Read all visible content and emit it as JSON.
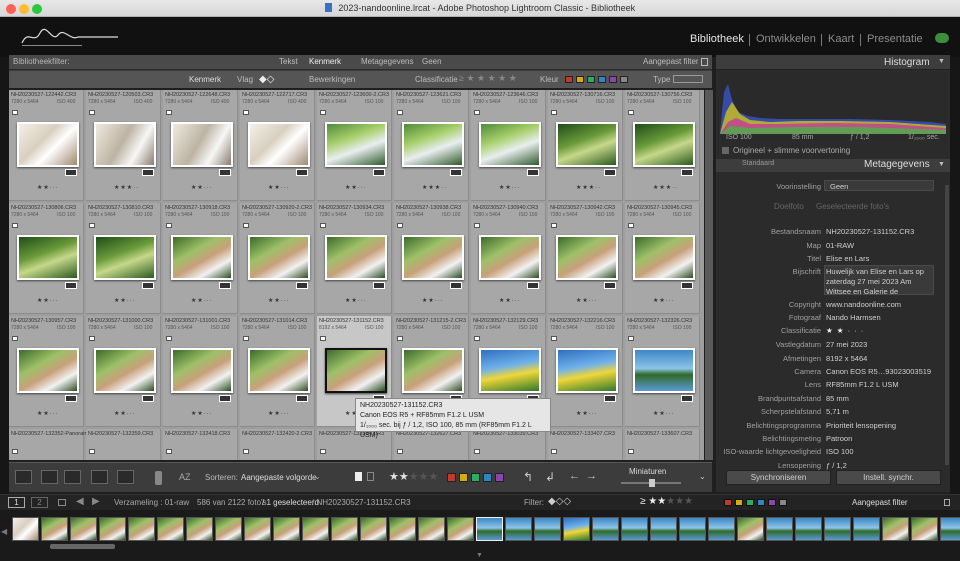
{
  "window": {
    "title": "2023-nandoonline.lrcat - Adobe Photoshop Lightroom Classic - Bibliotheek"
  },
  "modules": [
    "Bibliotheek",
    "Ontwikkelen",
    "Kaart",
    "Presentatie"
  ],
  "filterbar": {
    "title": "Bibliotheekfilter:",
    "tabs": [
      "Tekst",
      "Kenmerk",
      "Metagegevens",
      "Geen"
    ],
    "preset": "Aangepast filter",
    "attr_label": "Kenmerk",
    "flag_label": "Vlag",
    "edits_label": "Bewerkingen",
    "rating_label": "Classificatie",
    "color_label": "Kleur",
    "type_label": "Type",
    "colors": [
      "#c0392b",
      "#d4ac0d",
      "#27ae60",
      "#2e86c1",
      "#8e44ad",
      "#888888"
    ]
  },
  "grid": {
    "rows": [
      [
        {
          "name": "NH20230527-122442.CR3",
          "dims": "7280 x 5464",
          "iso": "ISO 400",
          "stars": 2,
          "thumb": "t-wedding"
        },
        {
          "name": "NH20230527-120503.CR3",
          "dims": "7280 x 5464",
          "iso": "ISO 400",
          "stars": 3,
          "thumb": "t-indoor"
        },
        {
          "name": "NH20230527-122648.CR3",
          "dims": "7280 x 5464",
          "iso": "ISO 400",
          "stars": 2,
          "thumb": "t-indoor"
        },
        {
          "name": "NH20230527-122717.CR3",
          "dims": "7280 x 5464",
          "iso": "ISO 400",
          "stars": 2,
          "thumb": "t-wedding"
        },
        {
          "name": "NH20230527-123600-2.CR3",
          "dims": "7280 x 5464",
          "iso": "ISO 100",
          "stars": 2,
          "thumb": "t-car"
        },
        {
          "name": "NH20230527-123621.CR3",
          "dims": "7280 x 5464",
          "iso": "ISO 100",
          "stars": 3,
          "thumb": "t-car"
        },
        {
          "name": "NH20230527-123646.CR3",
          "dims": "7280 x 5464",
          "iso": "ISO 100",
          "stars": 2,
          "thumb": "t-car"
        },
        {
          "name": "NH20230527-130716.CR3",
          "dims": "7280 x 5464",
          "iso": "ISO 100",
          "stars": 3,
          "thumb": "t-forest"
        },
        {
          "name": "NH20230527-130756.CR3",
          "dims": "7280 x 5464",
          "iso": "ISO 100",
          "stars": 3,
          "thumb": "t-forest"
        }
      ],
      [
        {
          "name": "NH20230527-130806.CR3",
          "dims": "7280 x 5464",
          "iso": "ISO 100",
          "stars": 2,
          "thumb": "t-forest"
        },
        {
          "name": "NH20230527-130810.CR3",
          "dims": "7280 x 5464",
          "iso": "ISO 100",
          "stars": 2,
          "thumb": "t-forest"
        },
        {
          "name": "NH20230527-130918.CR3",
          "dims": "7280 x 5464",
          "iso": "ISO 100",
          "stars": 2,
          "thumb": "t-couple"
        },
        {
          "name": "NH20230527-130920-2.CR3",
          "dims": "7280 x 5464",
          "iso": "ISO 100",
          "stars": 2,
          "thumb": "t-couple"
        },
        {
          "name": "NH20230527-130934.CR3",
          "dims": "7280 x 5464",
          "iso": "ISO 100",
          "stars": 2,
          "thumb": "t-couple"
        },
        {
          "name": "NH20230527-130938.CR3",
          "dims": "7280 x 5464",
          "iso": "ISO 100",
          "stars": 2,
          "thumb": "t-couple"
        },
        {
          "name": "NH20230527-130940.CR3",
          "dims": "7280 x 5464",
          "iso": "ISO 100",
          "stars": 2,
          "thumb": "t-couple"
        },
        {
          "name": "NH20230527-130942.CR3",
          "dims": "7280 x 5464",
          "iso": "ISO 100",
          "stars": 2,
          "thumb": "t-couple"
        },
        {
          "name": "NH20230527-130945.CR3",
          "dims": "7280 x 5464",
          "iso": "ISO 100",
          "stars": 2,
          "thumb": "t-couple"
        }
      ],
      [
        {
          "name": "NH20230527-130957.CR3",
          "dims": "7280 x 5464",
          "iso": "ISO 100",
          "stars": 2,
          "thumb": "t-couple"
        },
        {
          "name": "NH20230527-131000.CR3",
          "dims": "7280 x 5464",
          "iso": "ISO 100",
          "stars": 2,
          "thumb": "t-couple"
        },
        {
          "name": "NH20230527-131001.CR3",
          "dims": "7280 x 5464",
          "iso": "ISO 100",
          "stars": 2,
          "thumb": "t-couple"
        },
        {
          "name": "NH20230527-131014.CR3",
          "dims": "7280 x 5464",
          "iso": "ISO 100",
          "stars": 2,
          "thumb": "t-couple"
        },
        {
          "name": "NH20230527-131152.CR3",
          "dims": "8192 x 5464",
          "iso": "ISO 100",
          "stars": 2,
          "thumb": "t-couple",
          "selected": true
        },
        {
          "name": "NH20230527-131215-2.CR3",
          "dims": "7280 x 5464",
          "iso": "ISO 100",
          "stars": 2,
          "thumb": "t-couple"
        },
        {
          "name": "NH20230527-132129.CR3",
          "dims": "7280 x 5464",
          "iso": "ISO 100",
          "stars": 2,
          "thumb": "t-flower"
        },
        {
          "name": "NH20230527-132216.CR3",
          "dims": "7280 x 5464",
          "iso": "ISO 100",
          "stars": 2,
          "thumb": "t-flower"
        },
        {
          "name": "NH20230527-132326.CR3",
          "dims": "7280 x 5464",
          "iso": "ISO 100",
          "stars": 2,
          "thumb": "t-lake"
        }
      ],
      [
        {
          "name": "NH20230527-132352-Panorama",
          "dims": "",
          "iso": "",
          "stars": 0,
          "thumb": "t-lake"
        },
        {
          "name": "NH20230527-132359.CR3",
          "dims": "",
          "iso": "",
          "stars": 0,
          "thumb": "t-lake"
        },
        {
          "name": "NH20230527-132418.CR3",
          "dims": "",
          "iso": "",
          "stars": 0,
          "thumb": "t-lake"
        },
        {
          "name": "NH20230527-132420-2.CR3",
          "dims": "",
          "iso": "",
          "stars": 0,
          "thumb": "t-lake"
        },
        {
          "name": "NH20230527-132534.CR3",
          "dims": "",
          "iso": "",
          "stars": 0,
          "thumb": "t-lake"
        },
        {
          "name": "NH20230527-132627.CR3",
          "dims": "",
          "iso": "",
          "stars": 0,
          "thumb": "t-lake"
        },
        {
          "name": "NH20230527-133039.CR3",
          "dims": "",
          "iso": "",
          "stars": 0,
          "thumb": "t-lake"
        },
        {
          "name": "NH20230527-133407.CR3",
          "dims": "",
          "iso": "",
          "stars": 0,
          "thumb": "t-lake"
        },
        {
          "name": "NH20230527-133607.CR3",
          "dims": "",
          "iso": "",
          "stars": 0,
          "thumb": "t-lake"
        }
      ]
    ]
  },
  "tooltip": {
    "line1": "NH20230527-131152.CR3",
    "line2": "Canon EOS R5 + RF85mm F1.2 L USM",
    "line3": "1/₁₀₀₀ sec. bij ƒ / 1,2, ISO 100, 85 mm (RF85mm F1.2 L USM)"
  },
  "toolbar": {
    "sort_label": "Sorteren:",
    "sort_value": "Aangepaste volgorde",
    "thumbs_label": "Miniaturen",
    "colors": [
      "#c0392b",
      "#d4ac0d",
      "#27ae60",
      "#2e86c1",
      "#8e44ad"
    ]
  },
  "histogram": {
    "title": "Histogram",
    "iso": "ISO 100",
    "focal": "85 mm",
    "aperture": "ƒ / 1,2",
    "shutter": "1/₁₀₀₀ sec.",
    "original_label": "Origineel + slimme voorvertoning"
  },
  "metadata": {
    "title": "Metagegevens",
    "preset_dropdown": "Standaard",
    "preset_label": "Voorinstelling",
    "preset_value": "Geen",
    "target_photo": "Doelfoto",
    "selected_photos": "Geselecteerde foto's",
    "fields": [
      {
        "label": "Bestandsnaam",
        "value": "NH20230527-131152.CR3"
      },
      {
        "label": "Map",
        "value": "01-RAW"
      },
      {
        "label": "Titel",
        "value": "Elise en Lars"
      },
      {
        "label": "Bijschrift",
        "value": "Huwelijk van Elise en Lars op zaterdag 27 mei 2023 Am Wittsee en Galerie de"
      },
      {
        "label": "Copyright",
        "value": "www.nandoonline.com"
      },
      {
        "label": "Fotograaf",
        "value": "Nando Harmsen"
      },
      {
        "label": "Classificatie",
        "value": "★ ★ · · ·"
      },
      {
        "label": "Vastlegdatum",
        "value": "27 mei 2023"
      },
      {
        "label": "Afmetingen",
        "value": "8192 x 5464"
      },
      {
        "label": "Camera",
        "value": "Canon EOS R5…93023003519"
      },
      {
        "label": "Lens",
        "value": "RF85mm F1.2 L USM"
      },
      {
        "label": "Brandpuntsafstand",
        "value": "85 mm"
      },
      {
        "label": "Scherpstelafstand",
        "value": "5,71 m"
      },
      {
        "label": "Belichtingsprogramma",
        "value": "Prioriteit lensopening"
      },
      {
        "label": "Belichtingsmeting",
        "value": "Patroon"
      },
      {
        "label": "ISO-waarde lichtgevoeligheid",
        "value": "ISO 100"
      },
      {
        "label": "Lensopening",
        "value": "ƒ / 1,2"
      }
    ],
    "sync_button": "Synchroniseren",
    "sync_settings_button": "Instell. synchr."
  },
  "status": {
    "page1": "1",
    "page2": "2",
    "collection": "Verzameling : 01-raw",
    "count": "586 van 2122 foto's",
    "selected": "/ 1 geselecteerd",
    "file": "/ NH20230527-131152.CR3",
    "filter_label": "Filter:",
    "filter_value": "Aangepast filter"
  },
  "filmstrip": {
    "thumbs": [
      "t-wedding",
      "t-couple",
      "t-couple",
      "t-couple",
      "t-couple",
      "t-couple",
      "t-couple",
      "t-couple",
      "t-couple",
      "t-couple",
      "t-couple",
      "t-couple",
      "t-couple",
      "t-couple",
      "t-couple",
      "t-couple",
      "t-lake",
      "t-lake",
      "t-lake",
      "t-flower",
      "t-lake",
      "t-lake",
      "t-lake",
      "t-lake",
      "t-lake",
      "t-couple",
      "t-lake",
      "t-lake",
      "t-lake",
      "t-lake",
      "t-couple",
      "t-couple",
      "t-lake"
    ]
  }
}
